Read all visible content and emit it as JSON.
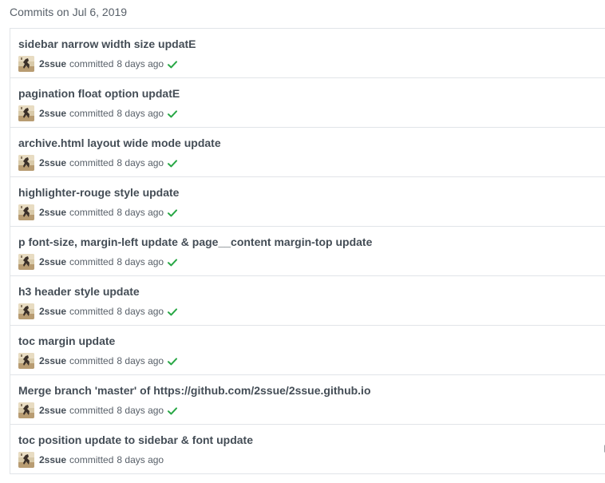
{
  "group": {
    "title": "Commits on Jul 6, 2019"
  },
  "colors": {
    "status_success": "#28a745",
    "muted_text": "#586069",
    "title_text": "#444d56",
    "border": "#e1e4e8"
  },
  "commits": [
    {
      "title": "sidebar narrow width size updatE",
      "author": "2ssue",
      "verb": "committed",
      "time": "8 days ago",
      "status": "check-icon"
    },
    {
      "title": "pagination float option updatE",
      "author": "2ssue",
      "verb": "committed",
      "time": "8 days ago",
      "status": "check-icon"
    },
    {
      "title": "archive.html layout wide mode update",
      "author": "2ssue",
      "verb": "committed",
      "time": "8 days ago",
      "status": "check-icon"
    },
    {
      "title": "highlighter-rouge style update",
      "author": "2ssue",
      "verb": "committed",
      "time": "8 days ago",
      "status": "check-icon"
    },
    {
      "title": "p font-size, margin-left update & page__content margin-top update",
      "author": "2ssue",
      "verb": "committed",
      "time": "8 days ago",
      "status": "check-icon"
    },
    {
      "title": "h3 header style update",
      "author": "2ssue",
      "verb": "committed",
      "time": "8 days ago",
      "status": "check-icon"
    },
    {
      "title": "toc margin update",
      "author": "2ssue",
      "verb": "committed",
      "time": "8 days ago",
      "status": "check-icon"
    },
    {
      "title": "Merge branch 'master' of https://github.com/2ssue/2ssue.github.io",
      "author": "2ssue",
      "verb": "committed",
      "time": "8 days ago",
      "status": "check-icon"
    },
    {
      "title": "toc position update to sidebar & font update",
      "author": "2ssue",
      "verb": "committed",
      "time": "8 days ago",
      "status": "",
      "comment_icon": "comment-icon"
    }
  ]
}
